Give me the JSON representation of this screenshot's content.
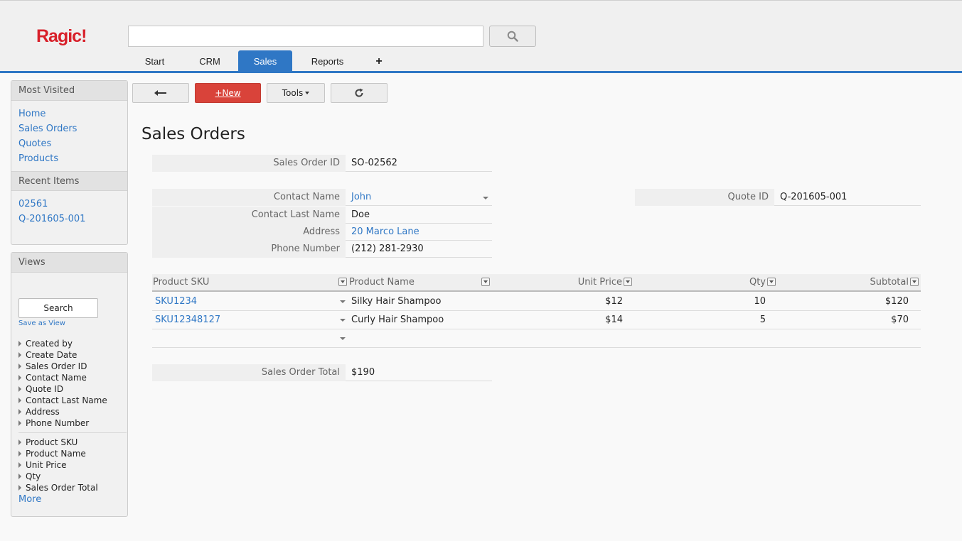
{
  "app": {
    "logo": "Ragic!"
  },
  "header": {
    "search_value": "",
    "tabs": [
      {
        "label": "Start",
        "active": false
      },
      {
        "label": "CRM",
        "active": false
      },
      {
        "label": "Sales",
        "active": true
      },
      {
        "label": "Reports",
        "active": false
      },
      {
        "label": "+",
        "active": false
      }
    ]
  },
  "sidebar": {
    "most_visited": {
      "title": "Most Visited",
      "items": [
        "Home",
        "Sales Orders",
        "Quotes",
        "Products"
      ]
    },
    "recent": {
      "title": "Recent Items",
      "items": [
        "02561",
        "Q-201605-001"
      ]
    },
    "views": {
      "title": "Views",
      "search_label": "Search",
      "save_as_view": "Save as View",
      "fields_group1": [
        "Created by",
        "Create Date",
        "Sales Order ID",
        "Contact Name",
        "Quote ID",
        "Contact Last Name",
        "Address",
        "Phone Number"
      ],
      "fields_group2": [
        "Product SKU",
        "Product Name",
        "Unit Price",
        "Qty",
        "Sales Order Total"
      ],
      "more": "More"
    }
  },
  "toolbar": {
    "back_icon": "arrow-left-icon",
    "new_label": "+New",
    "tools_label": "Tools",
    "refresh_icon": "refresh-icon"
  },
  "page": {
    "title": "Sales Orders",
    "fields": {
      "sales_order_id": {
        "label": "Sales Order ID",
        "value": "SO-02562"
      },
      "contact_name": {
        "label": "Contact Name",
        "value": "John"
      },
      "contact_last_name": {
        "label": "Contact Last Name",
        "value": "Doe"
      },
      "address": {
        "label": "Address",
        "value": "20 Marco Lane"
      },
      "phone": {
        "label": "Phone Number",
        "value": "(212) 281-2930"
      },
      "quote_id": {
        "label": "Quote ID",
        "value": "Q-201605-001"
      },
      "total": {
        "label": "Sales Order Total",
        "value": "$190"
      }
    },
    "subtable": {
      "headers": [
        "Product SKU",
        "Product Name",
        "Unit Price",
        "Qty",
        "Subtotal"
      ],
      "rows": [
        {
          "sku": "SKU1234",
          "name": "Silky Hair Shampoo",
          "price": "$12",
          "qty": "10",
          "subtotal": "$120"
        },
        {
          "sku": "SKU12348127",
          "name": "Curly Hair Shampoo",
          "price": "$14",
          "qty": "5",
          "subtotal": "$70"
        }
      ]
    }
  },
  "colors": {
    "brand": "#d8202a",
    "accent": "#2f77c5",
    "new_button": "#d9433a"
  }
}
